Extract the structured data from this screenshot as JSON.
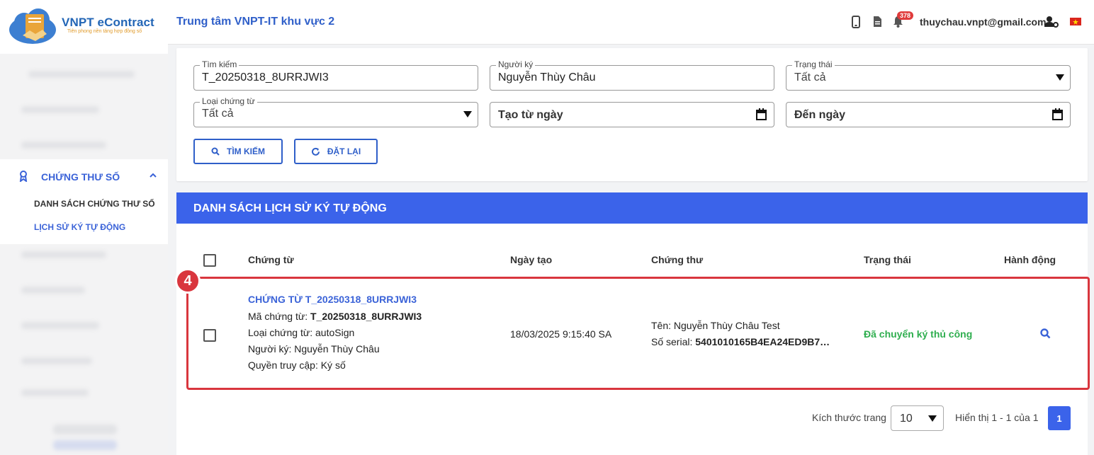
{
  "brand": {
    "name": "VNPT eContract",
    "tagline": "Tiên phong nền tảng hợp đồng số"
  },
  "sidebar": {
    "section_label": "CHỨNG THƯ SỐ",
    "sub_items": [
      {
        "label": "DANH SÁCH CHỨNG THƯ SỐ",
        "active": false
      },
      {
        "label": "LỊCH SỬ KÝ TỰ ĐỘNG",
        "active": true
      }
    ]
  },
  "header": {
    "org_title": "Trung tâm VNPT-IT khu vực 2",
    "notification_count": "378",
    "user_email": "thuychau.vnpt@gmail.com"
  },
  "filters": {
    "search": {
      "label": "Tìm kiếm",
      "value": "T_20250318_8URRJWI3"
    },
    "signer": {
      "label": "Người ký",
      "value": "Nguyễn Thùy Châu"
    },
    "status": {
      "label": "Trạng thái",
      "value": "Tất cả"
    },
    "doc_type": {
      "label": "Loại chứng từ",
      "value": "Tất cả"
    },
    "from_date": {
      "placeholder": "Tạo từ ngày"
    },
    "to_date": {
      "placeholder": "Đến ngày"
    },
    "search_button": "TÌM KIẾM",
    "reset_button": "ĐẶT LẠI"
  },
  "list": {
    "title": "DANH SÁCH LỊCH SỬ KÝ TỰ ĐỘNG",
    "columns": [
      "Chứng từ",
      "Ngày tạo",
      "Chứng thư",
      "Trạng thái",
      "Hành động"
    ],
    "rows": [
      {
        "doc_title": "CHỨNG TỪ T_20250318_8URRJWI3",
        "doc_code_label": "Mã chứng từ: ",
        "doc_code": "T_20250318_8URRJWI3",
        "doc_type": "Loại chứng từ: autoSign",
        "signer": "Người ký: Nguyễn Thùy Châu",
        "access": "Quyền truy cập: Ký số",
        "created": "18/03/2025 9:15:40 SA",
        "cert_name": "Tên: Nguyễn Thùy Châu Test",
        "serial_label": "Số serial: ",
        "serial": "5401010165B4EA24ED9B7…",
        "status": "Đã chuyển ký thủ công"
      }
    ]
  },
  "pagination": {
    "page_size_label": "Kích thước trang",
    "page_size": "10",
    "summary": "Hiển thị 1 - 1 của 1",
    "current_page": "1"
  },
  "annotation": {
    "step": "4"
  },
  "colors": {
    "primary": "#3b63ea",
    "success": "#2fae4f",
    "highlight": "#d9363e"
  }
}
